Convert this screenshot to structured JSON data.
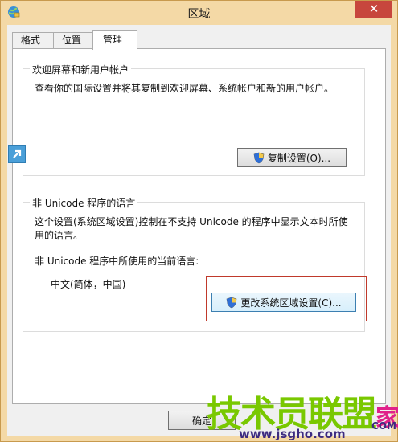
{
  "window": {
    "title": "区域",
    "close_label": "✕"
  },
  "tabs": [
    {
      "label": "格式"
    },
    {
      "label": "位置"
    },
    {
      "label": "管理"
    }
  ],
  "welcome_group": {
    "title": "欢迎屏幕和新用户帐户",
    "description": "查看你的国际设置并将其复制到欢迎屏幕、系统帐户和新的用户帐户。",
    "copy_button": "复制设置(O)..."
  },
  "unicode_group": {
    "title": "非 Unicode 程序的语言",
    "description_line1": "这个设置(系统区域设置)控制在不支持 Unicode 的程序中显示文本时所使",
    "description_line2": "用的语言。",
    "current_label": "非 Unicode 程序中所使用的当前语言:",
    "current_value": "中文(简体，中国)",
    "change_button": "更改系统区域设置(C)..."
  },
  "footer": {
    "ok_button": "确定"
  },
  "watermark": {
    "main": "技术员联盟",
    "suffix": "家",
    "url": "www.jsgho.com",
    "com": "COM"
  }
}
